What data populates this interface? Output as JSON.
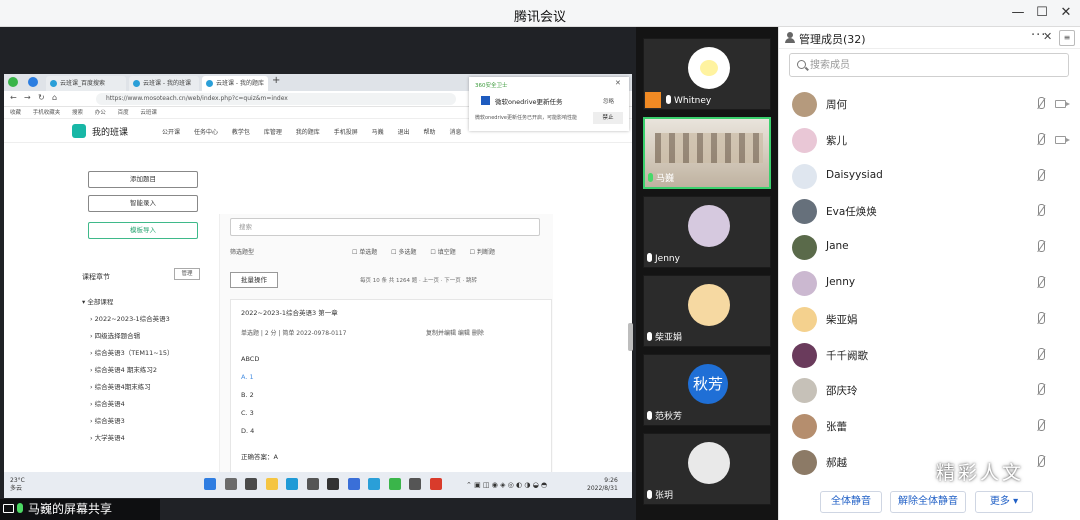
{
  "window": {
    "title": "腾讯会议"
  },
  "share": {
    "label": "马巍的屏幕共享",
    "browser": {
      "tabs": [
        "云班课_百度搜索",
        "云班课 - 我的班课",
        "云班课 - 我的题库"
      ],
      "url": "https://www.mosoteach.cn/web/index.php?c=quiz&m=index",
      "bookmarks": [
        "收藏",
        "手机收藏夹",
        "搜索",
        "办公",
        "百度",
        "云班课"
      ],
      "site": {
        "brand": "我的班课",
        "nav": [
          "公开课",
          "任务中心",
          "教学包",
          "库管理",
          "我的题库",
          "手机投屏",
          "马巍",
          "退出",
          "帮助",
          "消息"
        ]
      },
      "left": {
        "buttons": [
          "添加题目",
          "智能录入",
          "模板导入"
        ],
        "chapter_title": "课程章节",
        "manage": "管理",
        "chapters": [
          "全部课程",
          "2022~2023-1综合英语3",
          "四级选择题合辑",
          "综合英语3（TEM11~15）",
          "综合英语4 期末练习2",
          "综合英语4期末练习",
          "综合英语4",
          "综合英语3",
          "大学英语4"
        ]
      },
      "right": {
        "search_placeholder": "搜索",
        "filter_label": "筛选题型",
        "filters": [
          "单选题",
          "多选题",
          "填空题",
          "判断题"
        ],
        "batch": "批量操作",
        "pager": "每页 10 条 共 1264 题 · 上一页 · 下一页 · 跳转",
        "question": {
          "header": "2022~2023-1综合英语3   第一章",
          "meta": "单选题 | 2 分 | 简单   2022-0978-0117",
          "actions": "复制并编辑   编辑   删除",
          "stem": "ABCD",
          "options": [
            "A. 1",
            "B. 2",
            "C. 3",
            "D. 4"
          ],
          "answer": "正确答案：A"
        }
      },
      "notification": {
        "app": "360安全卫士",
        "title": "微软onedrive更新任务",
        "body": "微软onedrive更新任务已开启，可能影响性能",
        "btn_ignore": "忽略",
        "btn_block": "禁止"
      }
    },
    "taskbar": {
      "weather_temp": "23°C",
      "weather_desc": "多云",
      "time": "9:26",
      "date": "2022/8/31"
    }
  },
  "videos": [
    {
      "name": "Whitney",
      "mic": "off",
      "avatar_color": "#fff6a8"
    },
    {
      "name": "马巍",
      "mic": "on",
      "avatar_color": ""
    },
    {
      "name": "Jenny",
      "mic": "off",
      "avatar_color": "#d6c9df"
    },
    {
      "name": "柴亚娟",
      "mic": "off",
      "avatar_color": "#f6d9a2"
    },
    {
      "name": "范秋芳",
      "mic": "off",
      "avatar_text": "秋芳",
      "avatar_color": "#1f6fd6"
    },
    {
      "name": "张玥",
      "mic": "off",
      "avatar_color": "#e9e9e9"
    }
  ],
  "members": {
    "title": "管理成员(32)",
    "search_placeholder": "搜索成员",
    "list": [
      {
        "name": "周何",
        "color": "#b59a7d",
        "cam": true
      },
      {
        "name": "紫儿",
        "color": "#e9c7d6",
        "cam": true
      },
      {
        "name": "Daisyysiad",
        "color": "#dfe6ef",
        "cam": false
      },
      {
        "name": "Eva任焕焕",
        "color": "#66707b",
        "cam": false
      },
      {
        "name": "Jane",
        "color": "#5a6a4a",
        "cam": false
      },
      {
        "name": "Jenny",
        "color": "#cbb8d0",
        "cam": false
      },
      {
        "name": "柴亚娟",
        "color": "#f4d18e",
        "cam": false
      },
      {
        "name": "千千阙歌",
        "color": "#6a3b5c",
        "cam": false
      },
      {
        "name": "邵庆玲",
        "color": "#c6c1b8",
        "cam": false
      },
      {
        "name": "张蕾",
        "color": "#b58e6e",
        "cam": false
      },
      {
        "name": "郝越",
        "color": "#8c7a66",
        "cam": false
      }
    ],
    "footer": {
      "mute_all": "全体静音",
      "unmute_all": "解除全体静音",
      "more": "更多 ▾"
    }
  },
  "watermark": "精彩人文"
}
